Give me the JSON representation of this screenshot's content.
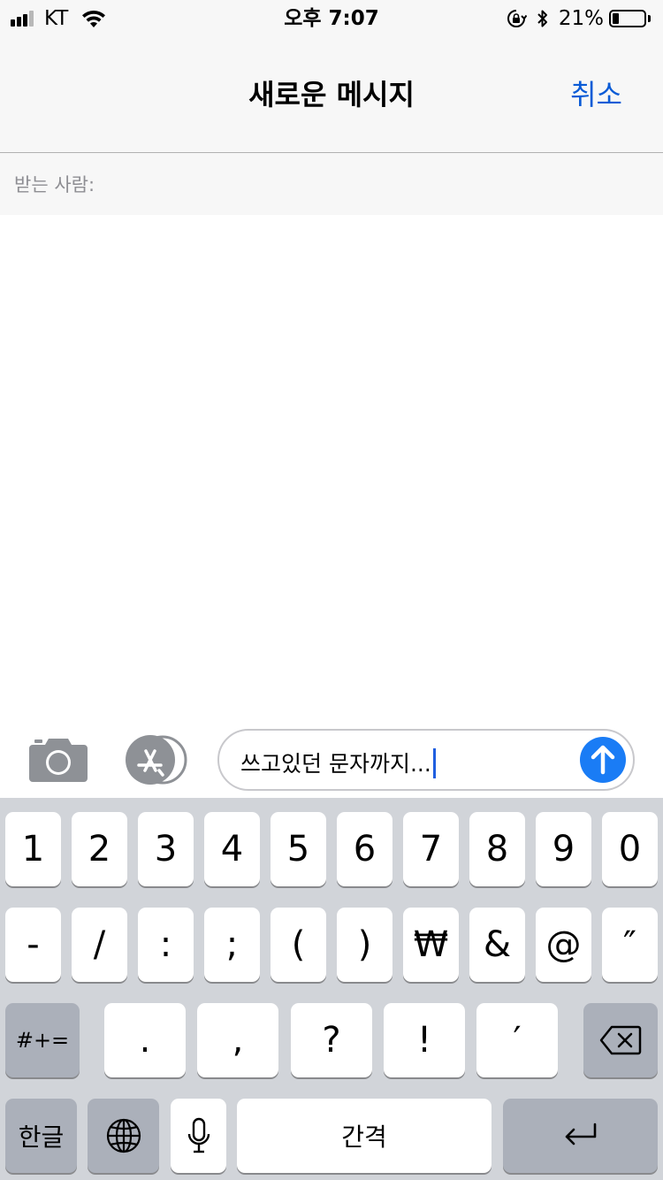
{
  "status_bar": {
    "carrier": "KT",
    "time": "오후 7:07",
    "battery_percent": "21%",
    "battery_level": 0.21
  },
  "nav": {
    "title": "새로운 메시지",
    "cancel_label": "취소"
  },
  "recipients": {
    "label": "받는 사람:"
  },
  "composer": {
    "text": "쓰고있던 문자까지..."
  },
  "keyboard": {
    "row1": [
      "1",
      "2",
      "3",
      "4",
      "5",
      "6",
      "7",
      "8",
      "9",
      "0"
    ],
    "row2": [
      "-",
      "/",
      ":",
      ";",
      "(",
      ")",
      "₩",
      "&",
      "@",
      "″"
    ],
    "row3": [
      ".",
      ",",
      "?",
      "!",
      "′"
    ],
    "more_symbols_label": "#+=",
    "hangul_label": "한글",
    "space_label": "간격"
  },
  "colors": {
    "accent": "#0a5bd6",
    "send": "#1a7cf5",
    "keyboard_bg": "#d1d4d9",
    "key_dark": "#abb0ba"
  },
  "icons": {
    "wifi": "wifi-icon",
    "rotation_lock": "rotation-lock-icon",
    "bluetooth": "bluetooth-icon",
    "camera": "camera-icon",
    "app_store": "app-store-icon",
    "send": "arrow-up-icon",
    "backspace": "backspace-icon",
    "globe": "globe-icon",
    "microphone": "microphone-icon",
    "return": "return-icon"
  }
}
